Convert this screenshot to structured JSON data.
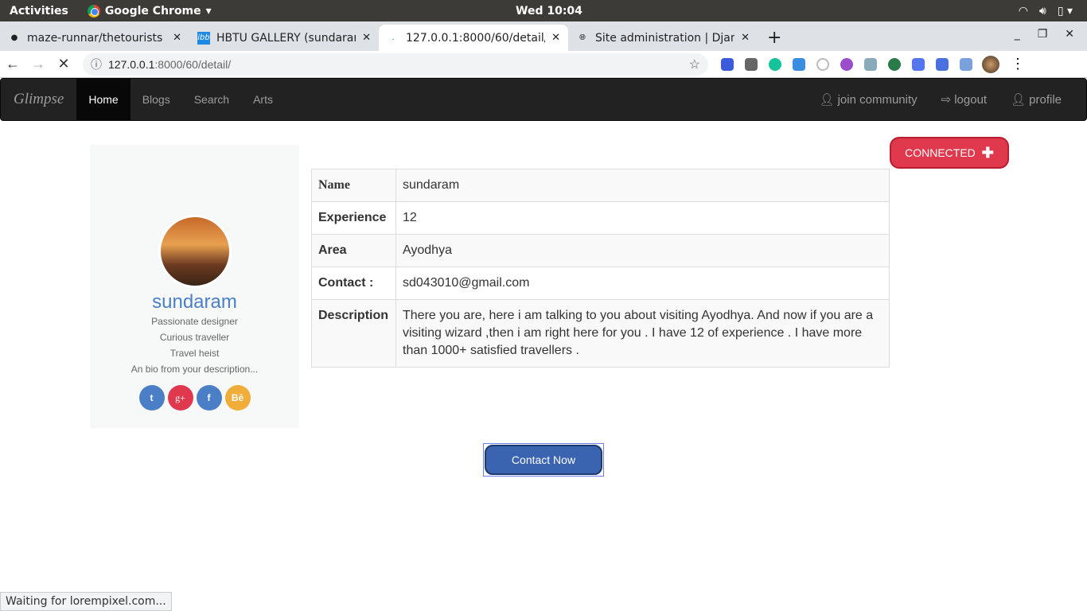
{
  "os": {
    "activities": "Activities",
    "app": "Google Chrome",
    "clock": "Wed 10:04"
  },
  "tabs": [
    {
      "title": "maze-runnar/thetourists"
    },
    {
      "title": "HBTU GALLERY (sundaram"
    },
    {
      "title": "127.0.0.1:8000/60/detail/"
    },
    {
      "title": "Site administration | Django"
    }
  ],
  "address": {
    "host": "127.0.0.1",
    "path": ":8000/60/detail/"
  },
  "site": {
    "brand": "Glimpse",
    "nav": [
      "Home",
      "Blogs",
      "Search",
      "Arts"
    ],
    "right": [
      "join community",
      "logout",
      "profile"
    ]
  },
  "profile": {
    "name": "sundaram",
    "bio": [
      "Passionate designer",
      "Curious traveller",
      "Travel heist",
      "An bio from your description..."
    ],
    "social": [
      "twitter",
      "google-plus",
      "facebook",
      "behance"
    ]
  },
  "connected_label": "CONNECTED",
  "details": [
    {
      "label": "Name",
      "value": "sundaram"
    },
    {
      "label": "Experience",
      "value": "12"
    },
    {
      "label": "Area",
      "value": "Ayodhya"
    },
    {
      "label": "Contact :",
      "value": "sd043010@gmail.com"
    },
    {
      "label": "Description",
      "value": "There you are, here i am talking to you about visiting Ayodhya. And now if you are a visiting wizard ,then i am right here for you . I have 12 of experience . I have more than 1000+ satisfied travellers ."
    }
  ],
  "contact_button": "Contact Now",
  "status": "Waiting for lorempixel.com..."
}
